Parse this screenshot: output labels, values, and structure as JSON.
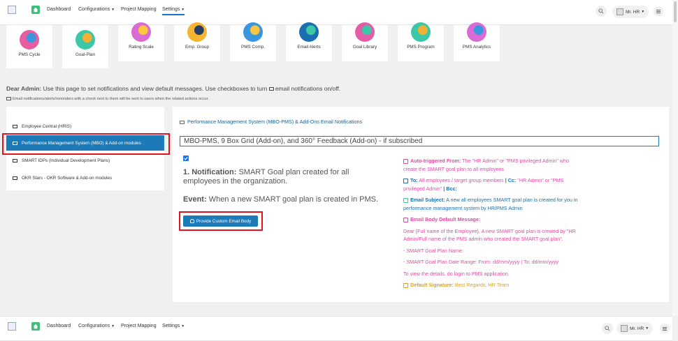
{
  "nav": {
    "items": [
      "Dashboard",
      "Configurations",
      "Project Mapping",
      "Settings"
    ],
    "user": "Mr. HR"
  },
  "tiles": [
    {
      "label": "PMS Cycle",
      "color": "#e85da0",
      "accent": "#3a97dd"
    },
    {
      "label": "Goal-Plan",
      "color": "#3cc7a8",
      "accent": "#f2b134"
    },
    {
      "label": "Rating Scale",
      "color": "#d96bd4",
      "accent": "#ffc73b"
    },
    {
      "label": "Emp. Group",
      "color": "#f5b531",
      "accent": "#2b3e63"
    },
    {
      "label": "PMS Comp.",
      "color": "#3b97dd",
      "accent": "#f7c443"
    },
    {
      "label": "Email Alerts",
      "color": "#1b6fb0",
      "accent": "#3cc7a8"
    },
    {
      "label": "Goal Library",
      "color": "#e45ea7",
      "accent": "#3cc7a8"
    },
    {
      "label": "PMS Program",
      "color": "#3cc7a8",
      "accent": "#f2b134"
    },
    {
      "label": "PMS Analytics",
      "color": "#d96bd4",
      "accent": "#3b97dd"
    }
  ],
  "intro": {
    "greeting": "Dear Admin:",
    "text": "Use this page to set notifications and view default messages. Use checkboxes to turn",
    "text_end": "email notifications on/off.",
    "note": "Email notifications/alerts/reminders with a check next to them will be sent to users when the related actions occur."
  },
  "sidebar": {
    "items": [
      "Employee Central (HRIS)",
      "Performance Management System (MBO) & Add-on modules",
      "SMART IDPs (Individual Development Plans)",
      "OKR Stars - OKR Software & Add-on modules"
    ]
  },
  "main": {
    "heading": "Performance Management System (MBO-PMS) & Add-Ons Email Notifications",
    "subject": "MBO-PMS, 9 Box Grid (Add-on), and 360° Feedback (Add-on) - if subscribed",
    "notif_label": "1. Notification:",
    "notif_text": "SMART Goal plan created for all employees in the organization.",
    "event_label": "Event:",
    "event_text": "When a new SMART goal plan is created in PMS.",
    "button": "Provide Custom Email Body",
    "auto_label": "Auto-triggered From:",
    "auto_text": "The \"HR Admin\" or \"PMS privileged Admin\" who create the SMART goal plan to all employees",
    "to_label": "To:",
    "to_text": "All employees / target group members",
    "cc_label": "| Cc:",
    "cc_text": "\"HR Admin\" or \"PMS privileged Admin\"",
    "bcc_label": "| Bcc:",
    "subject_label": "Email Subject:",
    "subject_text": "A new all employees SMART goal plan is created for you in performance management system by HR/PMS Admin",
    "body_label": "Email Body Default Message:",
    "body_text": "Dear {Full name of the Employee}, A new SMART goal plan is created by \"HR Admin/Full name of the PMS admin who created the SMART goal plan\".",
    "body_line1": "- SMART Goal Plan Name:",
    "body_line2": "- SMART Goal Plan Date Range: From: dd/mm/yyyy | To: dd/mm/yyyy",
    "body_line3": "To view the details, do login to PMS application.",
    "sig_label": "Default Signature:",
    "sig_text": "Best Regards, HR Team"
  }
}
